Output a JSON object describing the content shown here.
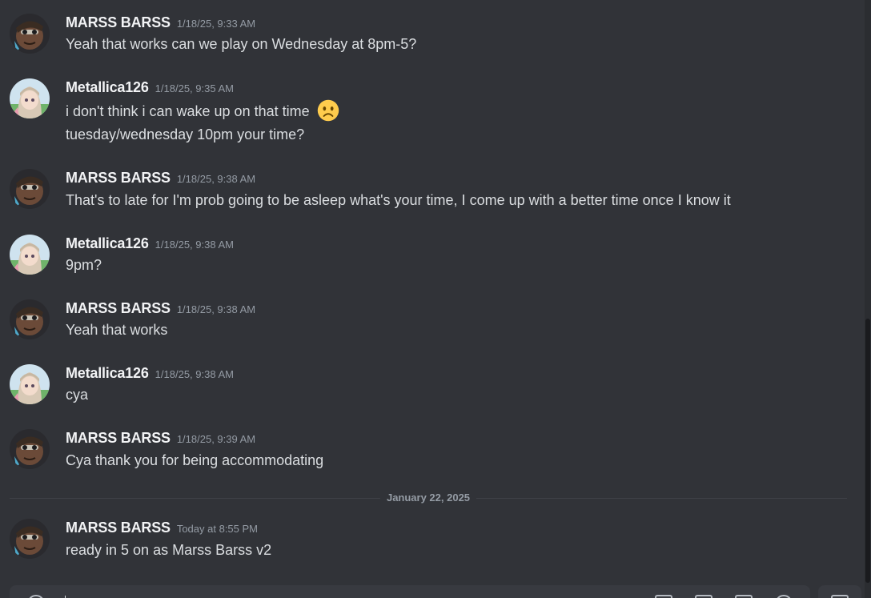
{
  "colors": {
    "background": "#313338",
    "username": "#f2f3f5",
    "message_text": "#dbdee1",
    "timestamp": "#949ba4",
    "divider": "#3f4147",
    "emoji_face": "#ffcc4d"
  },
  "messages": [
    {
      "author": "MARSS BARSS",
      "avatar_icon": "marss-barss-avatar",
      "timestamp": "1/18/25, 9:33 AM",
      "lines": [
        "Yeah that works can we play on Wednesday at 8pm-5?"
      ]
    },
    {
      "author": "Metallica126",
      "avatar_icon": "metallica126-avatar",
      "timestamp": "1/18/25, 9:35 AM",
      "lines": [
        "i don't think i can wake up on that time",
        "tuesday/wednesday 10pm your time?"
      ],
      "emoji": "frowning-face"
    },
    {
      "author": "MARSS BARSS",
      "avatar_icon": "marss-barss-avatar",
      "timestamp": "1/18/25, 9:38 AM",
      "lines": [
        "That's to late for I'm prob going to be asleep what's your time, I come up with a better time once I know it"
      ]
    },
    {
      "author": "Metallica126",
      "avatar_icon": "metallica126-avatar",
      "timestamp": "1/18/25, 9:38 AM",
      "lines": [
        "9pm?"
      ]
    },
    {
      "author": "MARSS BARSS",
      "avatar_icon": "marss-barss-avatar",
      "timestamp": "1/18/25, 9:38 AM",
      "lines": [
        "Yeah that works"
      ]
    },
    {
      "author": "Metallica126",
      "avatar_icon": "metallica126-avatar",
      "timestamp": "1/18/25, 9:38 AM",
      "lines": [
        "cya"
      ]
    },
    {
      "author": "MARSS BARSS",
      "avatar_icon": "marss-barss-avatar",
      "timestamp": "1/18/25, 9:39 AM",
      "lines": [
        "Cya thank you for being accommodating"
      ]
    },
    {
      "author": "MARSS BARSS",
      "avatar_icon": "marss-barss-avatar",
      "timestamp": "Today at 8:55 PM",
      "lines": [
        "ready in 5 on as Marss Barss v2"
      ]
    }
  ],
  "date_divider": "January 22, 2025"
}
